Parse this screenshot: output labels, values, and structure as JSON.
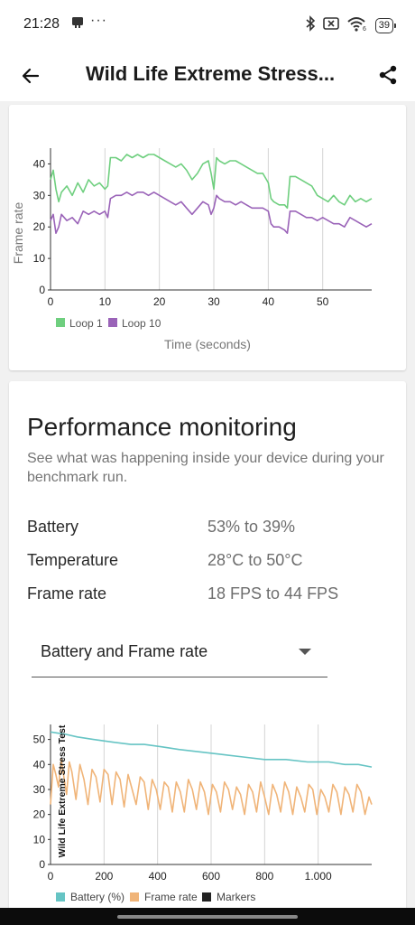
{
  "status_bar": {
    "time": "21:28",
    "dots": "···",
    "battery_level": "39",
    "icons": [
      "notification-icon",
      "bluetooth-icon",
      "no-sim-icon",
      "wifi-6-icon",
      "battery-icon"
    ]
  },
  "app_bar": {
    "title": "Wild Life Extreme Stress...",
    "back_icon": "arrow-left-icon",
    "share_icon": "share-icon"
  },
  "loop_chart": {
    "ylabel": "Frame rate",
    "xlabel": "Time (seconds)",
    "legend": [
      "Loop 1",
      "Loop 10"
    ]
  },
  "performance": {
    "title": "Performance monitoring",
    "description": "See what was happening inside your device during your benchmark run.",
    "stats": [
      {
        "label": "Battery",
        "value": "53% to 39%"
      },
      {
        "label": "Temperature",
        "value": "28°C to 50°C"
      },
      {
        "label": "Frame rate",
        "value": "18 FPS to 44 FPS"
      }
    ],
    "dropdown_value": "Battery and Frame rate"
  },
  "monitor_chart": {
    "rotated_label": "Wild Life Extreme Stress Test",
    "legend": [
      "Battery (%)",
      "Frame rate",
      "Markers"
    ]
  },
  "chart_data": [
    {
      "type": "line",
      "title": "",
      "xlabel": "Time (seconds)",
      "ylabel": "Frame rate",
      "xlim": [
        0,
        59
      ],
      "ylim": [
        0,
        45
      ],
      "x_ticks": [
        "0",
        "10",
        "20",
        "30",
        "40",
        "50"
      ],
      "y_ticks": [
        "0",
        "10",
        "20",
        "30",
        "40"
      ],
      "grid": "vertical",
      "legend_position": "bottom-left",
      "colors": {
        "Loop 1": "#6fcf7f",
        "Loop 10": "#9a63b8"
      },
      "series": [
        {
          "name": "Loop 1",
          "x": [
            0,
            0.5,
            1,
            1.5,
            2,
            3,
            4,
            5,
            6,
            7,
            8,
            9,
            10,
            10.5,
            11,
            12,
            13,
            14,
            15,
            16,
            17,
            18,
            19,
            20,
            21,
            22,
            23,
            24,
            25,
            26,
            27,
            28,
            29,
            29.5,
            30,
            30.5,
            31,
            32,
            33,
            34,
            35,
            36,
            37,
            38,
            39,
            40,
            40.5,
            41,
            42,
            43,
            43.5,
            44,
            45,
            46,
            47,
            48,
            49,
            50,
            51,
            52,
            53,
            54,
            55,
            56,
            57,
            58,
            59
          ],
          "y": [
            35,
            38,
            32,
            28,
            31,
            33,
            30,
            34,
            31,
            35,
            33,
            34,
            32,
            33,
            42,
            42,
            41,
            43,
            42,
            43,
            42,
            43,
            43,
            42,
            41,
            40,
            39,
            40,
            38,
            35,
            37,
            40,
            41,
            37,
            32,
            42,
            41,
            40,
            41,
            41,
            40,
            39,
            38,
            37,
            37,
            34,
            29,
            28,
            27,
            27,
            26,
            36,
            36,
            35,
            34,
            33,
            30,
            29,
            28,
            30,
            28,
            27,
            30,
            28,
            29,
            28,
            29
          ]
        },
        {
          "name": "Loop 10",
          "x": [
            0,
            0.5,
            1,
            1.5,
            2,
            3,
            4,
            5,
            6,
            7,
            8,
            9,
            10,
            10.5,
            11,
            12,
            13,
            14,
            15,
            16,
            17,
            18,
            19,
            20,
            21,
            22,
            23,
            24,
            25,
            26,
            27,
            28,
            29,
            29.5,
            30,
            30.5,
            31,
            32,
            33,
            34,
            35,
            36,
            37,
            38,
            39,
            40,
            40.5,
            41,
            42,
            43,
            43.5,
            44,
            45,
            46,
            47,
            48,
            49,
            50,
            51,
            52,
            53,
            54,
            55,
            56,
            57,
            58,
            59
          ],
          "y": [
            22,
            24,
            18,
            20,
            24,
            22,
            23,
            21,
            25,
            24,
            25,
            24,
            25,
            23,
            29,
            30,
            30,
            31,
            30,
            31,
            31,
            30,
            31,
            30,
            29,
            28,
            27,
            28,
            26,
            24,
            26,
            28,
            27,
            24,
            26,
            30,
            29,
            28,
            28,
            27,
            28,
            27,
            26,
            26,
            26,
            25,
            21,
            20,
            20,
            19,
            18,
            25,
            25,
            24,
            23,
            23,
            22,
            23,
            22,
            21,
            21,
            20,
            23,
            22,
            21,
            20,
            21
          ]
        }
      ]
    },
    {
      "type": "line",
      "title": "",
      "xlabel": "",
      "ylabel": "",
      "xlim": [
        0,
        1200
      ],
      "ylim": [
        0,
        56
      ],
      "x_ticks": [
        "0",
        "200",
        "400",
        "600",
        "800",
        "1.000"
      ],
      "y_ticks": [
        "0",
        "10",
        "20",
        "30",
        "40",
        "50"
      ],
      "grid": "vertical",
      "legend_position": "bottom-left",
      "colors": {
        "Battery (%)": "#66c4c4",
        "Frame rate": "#f0b478",
        "Markers": "#222222"
      },
      "series": [
        {
          "name": "Battery (%)",
          "x": [
            0,
            60,
            100,
            160,
            230,
            300,
            350,
            420,
            480,
            560,
            640,
            720,
            800,
            880,
            960,
            1040,
            1100,
            1150,
            1200
          ],
          "y": [
            53,
            52,
            51,
            50,
            49,
            48,
            48,
            47,
            46,
            45,
            44,
            43,
            42,
            42,
            41,
            41,
            40,
            40,
            39
          ]
        },
        {
          "name": "Frame rate",
          "x": [
            0,
            10,
            20,
            30,
            40,
            50,
            60,
            70,
            80,
            95,
            110,
            125,
            140,
            155,
            170,
            185,
            200,
            215,
            230,
            245,
            260,
            275,
            290,
            305,
            320,
            335,
            350,
            365,
            380,
            395,
            410,
            425,
            440,
            455,
            470,
            485,
            500,
            515,
            530,
            545,
            560,
            575,
            590,
            605,
            620,
            635,
            650,
            665,
            680,
            695,
            710,
            725,
            740,
            755,
            770,
            785,
            800,
            815,
            830,
            845,
            860,
            875,
            890,
            905,
            920,
            935,
            950,
            965,
            980,
            995,
            1010,
            1025,
            1040,
            1055,
            1070,
            1085,
            1100,
            1115,
            1130,
            1145,
            1160,
            1175,
            1190,
            1200
          ],
          "y": [
            24,
            40,
            36,
            31,
            42,
            35,
            28,
            41,
            37,
            26,
            40,
            34,
            24,
            38,
            35,
            25,
            38,
            36,
            24,
            37,
            34,
            23,
            36,
            30,
            24,
            35,
            33,
            22,
            34,
            30,
            22,
            33,
            31,
            21,
            33,
            29,
            21,
            34,
            30,
            22,
            33,
            29,
            20,
            32,
            29,
            21,
            33,
            30,
            22,
            31,
            28,
            20,
            32,
            29,
            21,
            33,
            27,
            20,
            32,
            28,
            21,
            33,
            29,
            20,
            31,
            27,
            21,
            32,
            30,
            20,
            30,
            27,
            21,
            32,
            29,
            20,
            31,
            28,
            21,
            32,
            29,
            20,
            27,
            24
          ]
        }
      ]
    }
  ]
}
